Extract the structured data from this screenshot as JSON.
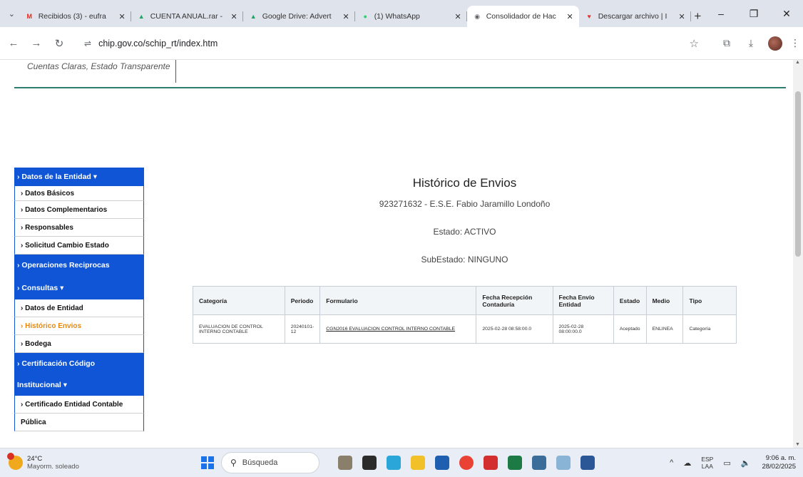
{
  "browser": {
    "tabs": [
      {
        "title": "Recibidos (3) - eufra",
        "favicon": "gmail-icon",
        "fav_glyph": "M",
        "fav_color": "#d93025",
        "active": false
      },
      {
        "title": "CUENTA ANUAL.rar -",
        "favicon": "drive-icon",
        "fav_glyph": "▲",
        "fav_color": "#1fa463",
        "active": false
      },
      {
        "title": "Google Drive: Advert",
        "favicon": "drive-icon",
        "fav_glyph": "▲",
        "fav_color": "#1fa463",
        "active": false
      },
      {
        "title": "(1) WhatsApp",
        "favicon": "whatsapp-icon",
        "fav_glyph": "●",
        "fav_color": "#25d366",
        "active": false
      },
      {
        "title": "Consolidador de Hac",
        "favicon": "globe-icon",
        "fav_glyph": "◉",
        "fav_color": "#5f6368",
        "active": true
      },
      {
        "title": "Descargar archivo | I",
        "favicon": "heart-icon",
        "fav_glyph": "♥",
        "fav_color": "#e53935",
        "active": false
      }
    ],
    "url": "chip.gov.co/schip_rt/index.htm"
  },
  "page": {
    "slogan": "Cuentas Claras, Estado Transparente"
  },
  "sidebar": {
    "items": [
      {
        "label": "› Datos de la Entidad ▾",
        "kind": "head",
        "h": 26
      },
      {
        "label": "› Datos Básicos",
        "kind": "sub",
        "h": 21
      },
      {
        "label": "› Datos Complementarios",
        "kind": "sub",
        "h": 25
      },
      {
        "label": "› Responsables",
        "kind": "sub",
        "h": 25
      },
      {
        "label": "› Solicitud Cambio Estado",
        "kind": "sub",
        "h": 25
      },
      {
        "label": "› Operaciones Reciprocas",
        "kind": "head",
        "h": 30
      },
      {
        "label": "› Consultas ▾",
        "kind": "head",
        "h": 33
      },
      {
        "label": "› Datos de Entidad",
        "kind": "sub",
        "h": 25
      },
      {
        "label": "› Histórico Envios",
        "kind": "sub",
        "h": 25,
        "current": true
      },
      {
        "label": "› Bodega",
        "kind": "sub",
        "h": 25
      },
      {
        "label": "› Certificación Código",
        "kind": "head",
        "h": 30
      },
      {
        "label": "Institucional ▾",
        "kind": "head",
        "h": 30
      },
      {
        "label": "› Certificado Entidad Contable",
        "kind": "sub",
        "h": 25
      },
      {
        "label": "Pública",
        "kind": "sub",
        "h": 25
      }
    ]
  },
  "main": {
    "title": "Histórico de Envios",
    "entity": "923271632 - E.S.E. Fabio Jaramillo Londoño",
    "estado": "Estado: ACTIVO",
    "subestado": "SubEstado: NINGUNO",
    "table": {
      "headers": [
        "Categoría",
        "Periodo",
        "Formulario",
        "Fecha Recepción Contaduría",
        "Fecha Envío Entidad",
        "Estado",
        "Medio",
        "Tipo"
      ],
      "rows": [
        [
          "EVALUACION DE CONTROL INTERNO CONTABLE",
          "20240101-12",
          "CGN2016 EVALUACION CONTROL INTERNO CONTABLE",
          "2025-02-28 08:58:00.0",
          "2025-02-28 08:00:00.0",
          "Aceptado",
          "ENLINEA",
          "Categoría"
        ]
      ]
    }
  },
  "taskbar": {
    "weather_temp": "24°C",
    "weather_desc": "Mayorm. soleado",
    "search_placeholder": "Búsqueda",
    "lang_1": "ESP",
    "lang_2": "LAA",
    "time": "9:06 a. m.",
    "date": "28/02/2025"
  }
}
